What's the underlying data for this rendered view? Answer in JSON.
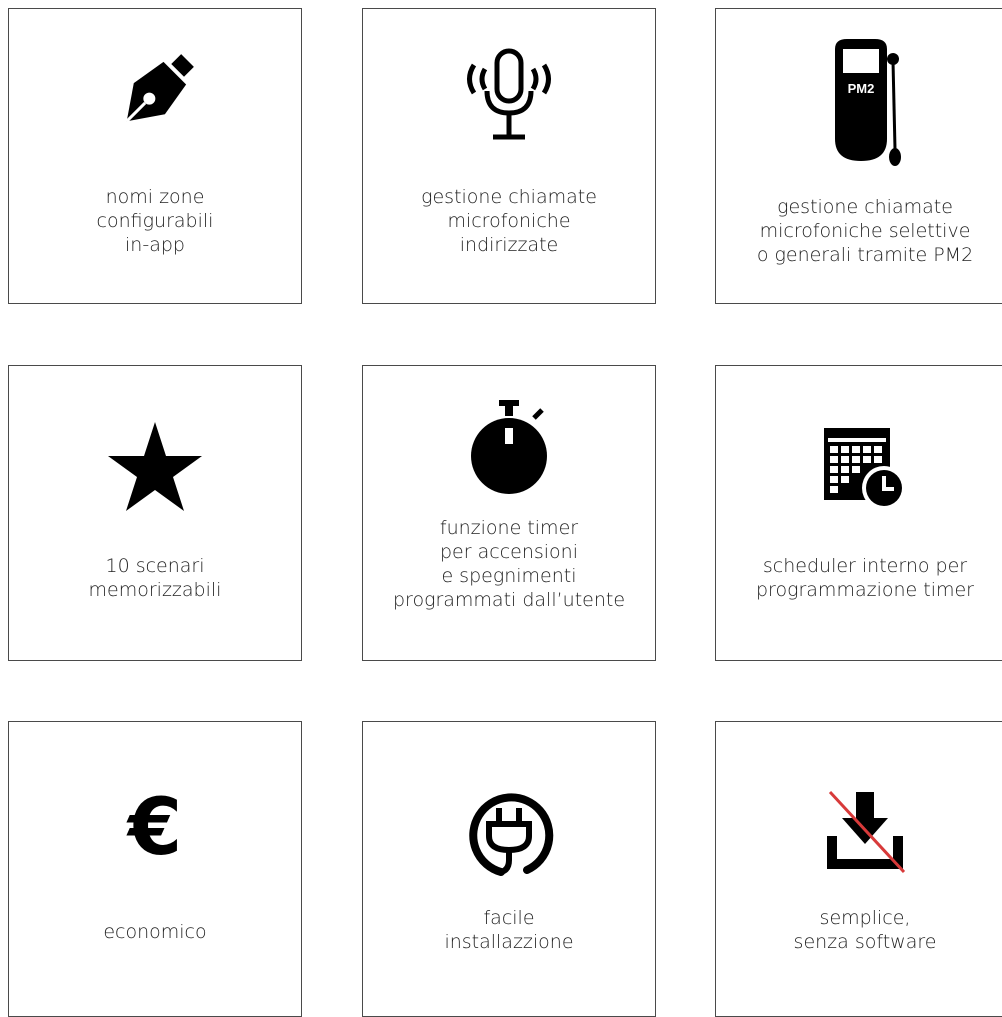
{
  "features": [
    {
      "icon": "fountain-pen-icon",
      "lines": [
        "nomi zone",
        "configurabili",
        "in-app"
      ]
    },
    {
      "icon": "microphone-broadcast-icon",
      "lines": [
        "gestione chiamate",
        "microfoniche",
        "indirizzate"
      ]
    },
    {
      "icon": "pm2-paging-microphone-icon",
      "icon_text": "PM2",
      "lines": [
        "gestione chiamate",
        "microfoniche selettive",
        "o generali tramite PM2"
      ]
    },
    {
      "icon": "star-icon",
      "lines": [
        "10 scenari",
        "memorizzabili"
      ]
    },
    {
      "icon": "stopwatch-icon",
      "lines": [
        "funzione timer",
        "per accensioni",
        "e spegnimenti",
        "programmati dall’utente"
      ]
    },
    {
      "icon": "calendar-clock-icon",
      "lines": [
        "scheduler interno per",
        "programmazione timer"
      ]
    },
    {
      "icon": "euro-icon",
      "icon_text": "€",
      "lines": [
        "economico"
      ]
    },
    {
      "icon": "plug-icon",
      "lines": [
        "facile",
        "installazzione"
      ]
    },
    {
      "icon": "no-download-icon",
      "lines": [
        "semplice,",
        "senza software"
      ]
    }
  ]
}
